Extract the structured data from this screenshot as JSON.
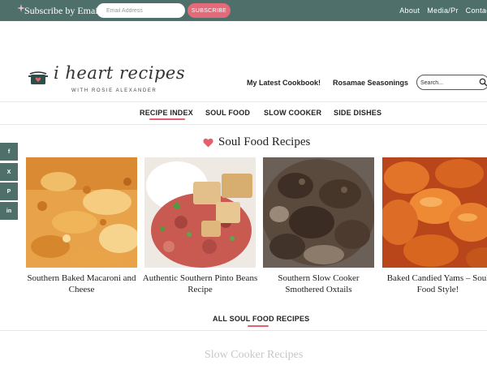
{
  "topbar": {
    "subscribe_label": "Subscribe by Email",
    "email_placeholder": "Email Address",
    "subscribe_button": "SUBSCRIBE",
    "links": [
      "About",
      "Media/Pr",
      "Contac"
    ]
  },
  "header": {
    "logo_text": "i heart recipes",
    "logo_tagline": "WITH ROSIE ALEXANDER",
    "links": [
      "My Latest Cookbook!",
      "Rosamae Seasonings"
    ],
    "search_placeholder": "Search..."
  },
  "nav": {
    "items": [
      "RECIPE INDEX",
      "SOUL FOOD",
      "SLOW COOKER",
      "SIDE DISHES"
    ],
    "active": "RECIPE INDEX"
  },
  "social": [
    {
      "icon": "facebook-icon",
      "glyph": "f"
    },
    {
      "icon": "x-icon",
      "glyph": "X"
    },
    {
      "icon": "pinterest-icon",
      "glyph": "P"
    },
    {
      "icon": "linkedin-icon",
      "glyph": "in"
    }
  ],
  "section": {
    "title": "Soul Food Recipes",
    "cards": [
      {
        "title": "Southern Baked Macaroni and Cheese"
      },
      {
        "title": "Authentic Southern Pinto Beans Recipe"
      },
      {
        "title": "Southern Slow Cooker Smothered Oxtails"
      },
      {
        "title": "Baked Candied Yams – Soul Food Style!"
      }
    ],
    "all_link": "ALL SOUL FOOD RECIPES"
  },
  "next_section": {
    "title": "Slow Cooker Recipes"
  },
  "colors": {
    "topbar": "#4f6f6b",
    "accent": "#e4606e",
    "text": "#222222"
  }
}
